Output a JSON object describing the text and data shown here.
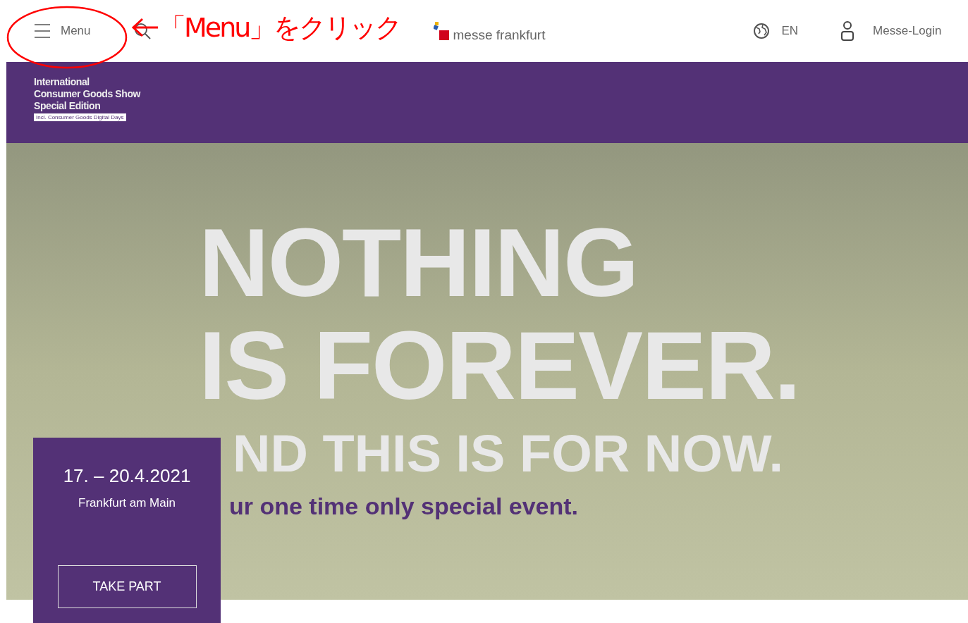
{
  "header": {
    "menu_label": "Menu",
    "brand": "messe frankfurt",
    "language": "EN",
    "login": "Messe-Login"
  },
  "annotation": {
    "text": "「Menu」をクリック"
  },
  "banner": {
    "title_lines": [
      "International",
      "Consumer Goods Show",
      "Special Edition"
    ],
    "tagline": "Incl. Consumer Goods Digital Days"
  },
  "hero": {
    "lines": [
      {
        "kind": "headline",
        "text": "NOTHING"
      },
      {
        "kind": "headline",
        "text": "IS FOREVER."
      },
      {
        "kind": "subhead",
        "text": "ND THIS IS FOR NOW."
      },
      {
        "kind": "tagline",
        "text": "ur one time only special event."
      }
    ]
  },
  "event_card": {
    "dates": "17. – 20.4.2021",
    "location": "Frankfurt am Main",
    "button": "TAKE PART"
  }
}
